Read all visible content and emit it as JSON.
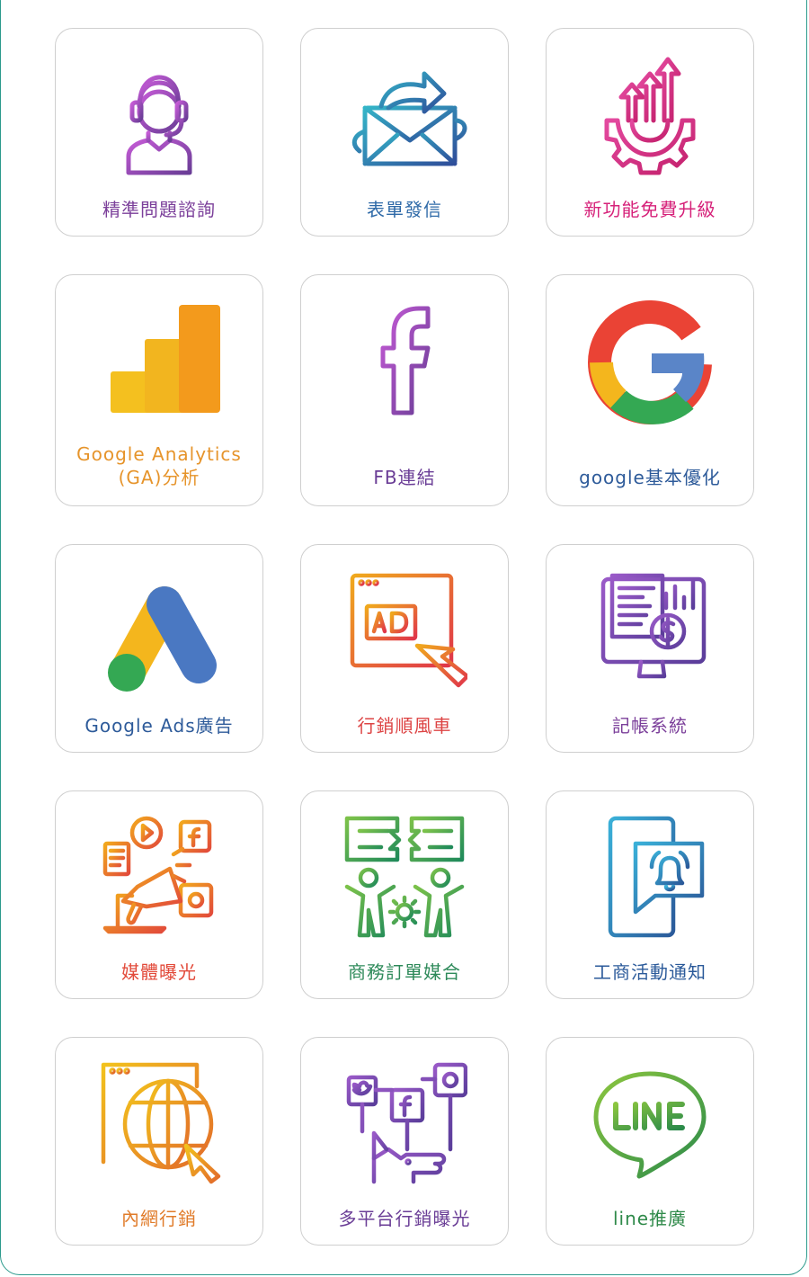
{
  "cards": [
    {
      "label": "精準問題諮詢",
      "color": "#7b3f9a",
      "icon": "headset-agent-icon"
    },
    {
      "label": "表單發信",
      "color": "#2f6aa8",
      "icon": "envelope-send-icon"
    },
    {
      "label": "新功能免費升級",
      "color": "#d6227a",
      "icon": "gear-upgrade-icon"
    },
    {
      "label": "Google Analytics",
      "label2": "(GA)分析",
      "color": "#e6942b",
      "icon": "google-analytics-icon"
    },
    {
      "label": "FB連結",
      "color": "#6a3d96",
      "icon": "facebook-icon"
    },
    {
      "label": "google基本優化",
      "color": "#2e5b9a",
      "icon": "google-g-icon"
    },
    {
      "label": "Google Ads廣告",
      "color": "#2e5b9a",
      "icon": "google-ads-icon"
    },
    {
      "label": "行銷順風車",
      "color": "#dd4444",
      "icon": "ad-click-icon"
    },
    {
      "label": "記帳系統",
      "color": "#7b3f9a",
      "icon": "accounting-monitor-icon"
    },
    {
      "label": "媒體曝光",
      "color": "#e24a3a",
      "icon": "megaphone-media-icon"
    },
    {
      "label": "商務訂單媒合",
      "color": "#2e8a5a",
      "icon": "business-matching-icon"
    },
    {
      "label": "工商活動通知",
      "color": "#2b5a9a",
      "icon": "phone-notification-icon"
    },
    {
      "label": "內網行銷",
      "color": "#e07b2a",
      "icon": "web-globe-icon"
    },
    {
      "label": "多平台行銷曝光",
      "color": "#6a3d96",
      "icon": "multi-platform-icon"
    },
    {
      "label": "line推廣",
      "color": "#2f8a4a",
      "icon": "line-app-icon"
    }
  ]
}
